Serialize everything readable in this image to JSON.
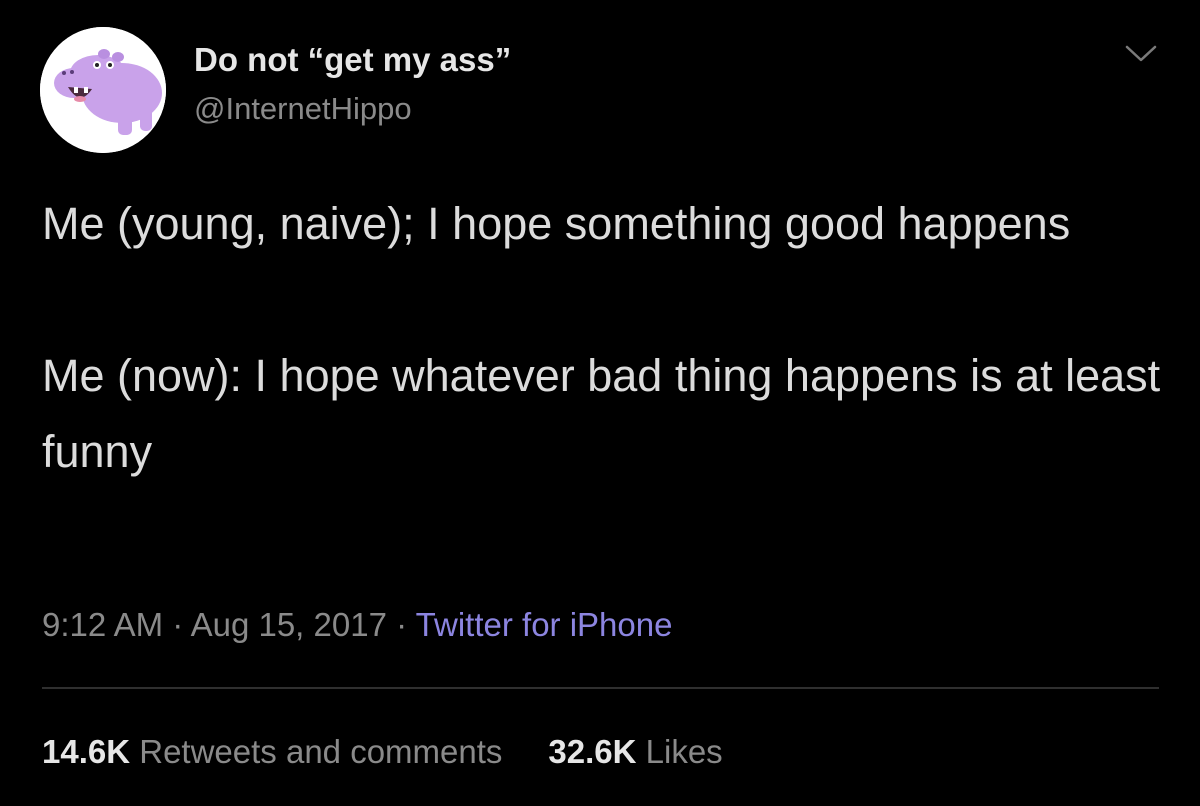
{
  "user": {
    "display_name": "Do not “get my ass”",
    "handle": "@InternetHippo",
    "avatar_icon": "purple-hippo-avatar"
  },
  "tweet": {
    "paragraphs": [
      "Me (young, naive); I hope something good happens",
      "Me (now): I hope whatever bad thing happens is at least funny"
    ],
    "time": "9:12 AM",
    "separator": " · ",
    "date": "Aug 15, 2017",
    "source": "Twitter for iPhone"
  },
  "stats": {
    "retweets_count": "14.6K",
    "retweets_label": "Retweets and comments",
    "likes_count": "32.6K",
    "likes_label": "Likes"
  },
  "colors": {
    "background": "#000000",
    "text": "#dcdcdc",
    "muted": "#8a8a8a",
    "link": "#8c85e0",
    "avatar_hippo": "#c9a2ea"
  }
}
